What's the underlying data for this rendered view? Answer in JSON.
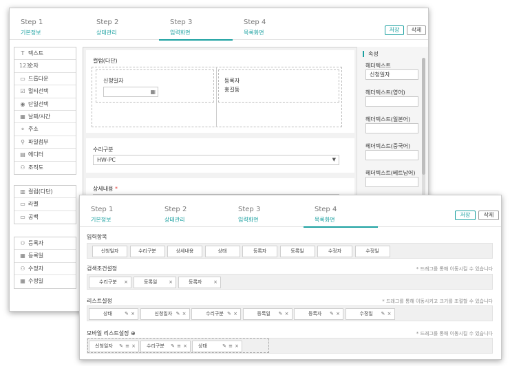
{
  "screen1": {
    "steps": [
      {
        "num": "Step 1",
        "name": "기본정보"
      },
      {
        "num": "Step 2",
        "name": "상태관리"
      },
      {
        "num": "Step 3",
        "name": "입력화면"
      },
      {
        "num": "Step 4",
        "name": "목록화면"
      }
    ],
    "active_step": 2,
    "buttons": {
      "save": "저장",
      "delete": "삭제"
    },
    "palette_groups": [
      [
        {
          "icon": "T",
          "label": "텍스트",
          "icon_name": "text-icon"
        },
        {
          "icon": "123",
          "label": "숫자",
          "icon_name": "number-icon"
        },
        {
          "icon": "▭",
          "label": "드롭다운",
          "icon_name": "dropdown-icon"
        },
        {
          "icon": "☑",
          "label": "멀티선택",
          "icon_name": "checkbox-icon"
        },
        {
          "icon": "◉",
          "label": "단일선택",
          "icon_name": "radio-icon"
        },
        {
          "icon": "▦",
          "label": "날짜/시간",
          "icon_name": "calendar-icon"
        },
        {
          "icon": "⌖",
          "label": "주소",
          "icon_name": "location-icon"
        },
        {
          "icon": "⚲",
          "label": "파일첨부",
          "icon_name": "attachment-icon"
        },
        {
          "icon": "▤",
          "label": "에디터",
          "icon_name": "editor-icon"
        },
        {
          "icon": "⚇",
          "label": "조직도",
          "icon_name": "org-chart-icon"
        }
      ],
      [
        {
          "icon": "▥",
          "label": "컬럼(다단)",
          "icon_name": "columns-icon"
        },
        {
          "icon": "▭",
          "label": "라벨",
          "icon_name": "label-icon"
        },
        {
          "icon": "▭",
          "label": "공백",
          "icon_name": "blank-icon"
        }
      ],
      [
        {
          "icon": "⚇",
          "label": "등록자",
          "icon_name": "user-icon"
        },
        {
          "icon": "▦",
          "label": "등록일",
          "icon_name": "calendar-icon"
        },
        {
          "icon": "⚇",
          "label": "수정자",
          "icon_name": "user-icon"
        },
        {
          "icon": "▦",
          "label": "수정일",
          "icon_name": "calendar-icon"
        }
      ]
    ],
    "canvas": {
      "column_title": "컬럼(다단)",
      "date_label": "신청일자",
      "registrant_label": "등록자",
      "registrant_value": "홍길동",
      "repair_label": "수리구분",
      "repair_value": "HW-PC",
      "detail_label": "상세내용",
      "required_mark": "*"
    },
    "props": {
      "title": "속성",
      "fields": [
        {
          "label": "헤더텍스트",
          "value": "신청일자"
        },
        {
          "label": "헤더텍스트(영어)",
          "value": ""
        },
        {
          "label": "헤더텍스트(일본어)",
          "value": ""
        },
        {
          "label": "헤더텍스트(중국어)",
          "value": ""
        },
        {
          "label": "헤더텍스트(베트남어)",
          "value": ""
        }
      ]
    }
  },
  "screen2": {
    "steps": [
      {
        "num": "Step 1",
        "name": "기본정보"
      },
      {
        "num": "Step 2",
        "name": "상태관리"
      },
      {
        "num": "Step 3",
        "name": "입력화면"
      },
      {
        "num": "Step 4",
        "name": "목록화면"
      }
    ],
    "active_step": 3,
    "buttons": {
      "save": "저장",
      "delete": "삭제"
    },
    "input_items": {
      "title": "입력항목",
      "items": [
        "신청일자",
        "수리구분",
        "상세내용",
        "상태",
        "등록자",
        "등록일",
        "수정자",
        "수정일"
      ]
    },
    "search": {
      "title": "검색조건설정",
      "hint": "* 드래그를 통해 이동시킬 수 있습니다",
      "items": [
        "수리구분",
        "등록일",
        "등록자"
      ]
    },
    "list": {
      "title": "리스트설정",
      "hint": "* 드래그를 통해 이동시키고 크기를 조절할 수 있습니다",
      "items": [
        "상태",
        "신청일자",
        "수리구분",
        "등록일",
        "등록자",
        "수정일"
      ]
    },
    "mobile": {
      "title": "모바일 리스트설정",
      "add_icon": "⊕",
      "hint": "* 드래그를 통해 이동시킬 수 있습니다",
      "items": [
        "신청일자",
        "수리구분",
        "상태"
      ]
    },
    "icons": {
      "close": "×",
      "edit": "✎",
      "drag": "≡"
    }
  }
}
